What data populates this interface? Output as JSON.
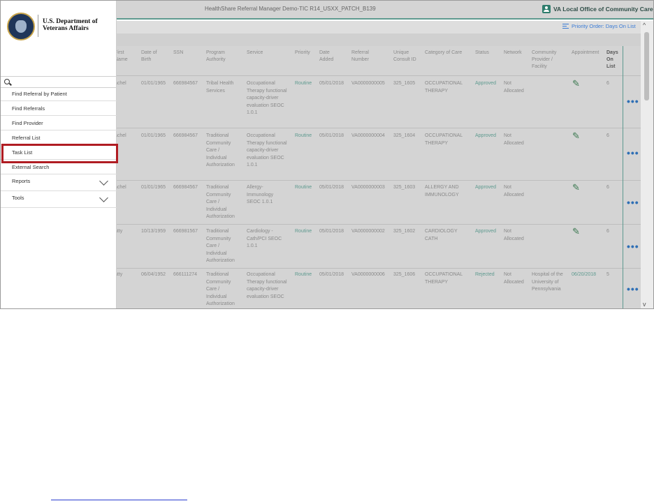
{
  "app": {
    "title": "HealthShare Referral Manager Demo-TIC R14_USXX_PATCH_B139",
    "office": "VA Local Office of Community Care",
    "priority_order": "Priority Order: Days On List"
  },
  "logo": {
    "org_name": "U.S. Department of Veterans Affairs"
  },
  "search": {
    "value": "",
    "placeholder": ""
  },
  "nav": {
    "items": [
      {
        "label": "Find Referral by Patient"
      },
      {
        "label": "Find Referrals"
      },
      {
        "label": "Find Provider"
      },
      {
        "label": "Referral List"
      },
      {
        "label": "Task List"
      },
      {
        "label": "External Search"
      },
      {
        "label": "Reports"
      },
      {
        "label": "Tools"
      }
    ]
  },
  "table": {
    "headers": {
      "first_name": "First Name",
      "dob": "Date of Birth",
      "ssn": "SSN",
      "program": "Program Authority",
      "service": "Service",
      "priority": "Priority",
      "date_added": "Date Added",
      "referral": "Referral Number",
      "consult": "Unique Consult ID",
      "category": "Category of Care",
      "status": "Status",
      "network": "Network",
      "provider": "Community Provider / Facility",
      "appointment": "Appointment",
      "days": "Days On List"
    },
    "rows": [
      {
        "first": "achel",
        "dob": "01/01/1965",
        "ssn": "666984567",
        "program": "Tribal Health Services",
        "service": "Occupational Therapy functional capacity-driver evaluation SEOC 1.0.1",
        "priority": "Routine",
        "added": "05/01/2018",
        "referral": "VA0000000005",
        "consult": "325_1605",
        "category": "OCCUPATIONAL THERAPY",
        "status": "Approved",
        "network": "Not Allocated",
        "provider": "",
        "appointment": "",
        "days": "6"
      },
      {
        "first": "achel",
        "dob": "01/01/1965",
        "ssn": "666984567",
        "program": "Traditional Community Care / Individual Authorization",
        "service": "Occupational Therapy functional capacity-driver evaluation SEOC 1.0.1",
        "priority": "Routine",
        "added": "05/01/2018",
        "referral": "VA0000000004",
        "consult": "325_1604",
        "category": "OCCUPATIONAL THERAPY",
        "status": "Approved",
        "network": "Not Allocated",
        "provider": "",
        "appointment": "",
        "days": "6"
      },
      {
        "first": "achel",
        "dob": "01/01/1965",
        "ssn": "666984567",
        "program": "Traditional Community Care / Individual Authorization",
        "service": "Allergy-Immunology SEOC 1.0.1",
        "priority": "Routine",
        "added": "05/01/2018",
        "referral": "VA0000000003",
        "consult": "325_1603",
        "category": "ALLERGY AND IMMUNOLOGY",
        "status": "Approved",
        "network": "Not Allocated",
        "provider": "",
        "appointment": "",
        "days": "6"
      },
      {
        "first": "atty",
        "dob": "10/13/1959",
        "ssn": "666981567",
        "program": "Traditional Community Care / Individual Authorization",
        "service": "Cardiology - Cath/PCI SEOC 1.0.1",
        "priority": "Routine",
        "added": "05/01/2018",
        "referral": "VA0000000002",
        "consult": "325_1602",
        "category": "CARDIOLOGY CATH",
        "status": "Approved",
        "network": "Not Allocated",
        "provider": "",
        "appointment": "",
        "days": "6"
      },
      {
        "first": "atty",
        "dob": "06/04/1952",
        "ssn": "666111274",
        "program": "Traditional Community Care / Individual Authorization",
        "service": "Occupational Therapy functional capacity-driver evaluation SEOC",
        "priority": "Routine",
        "added": "05/01/2018",
        "referral": "VA0000000006",
        "consult": "325_1606",
        "category": "OCCUPATIONAL THERAPY",
        "status": "Rejected",
        "network": "Not Allocated",
        "provider": "Hospital of the University of Pennsylvania",
        "appointment": "06/20/2018",
        "days": "5"
      }
    ]
  },
  "colors": {
    "accent": "#5e9a8f",
    "link": "#3a7bd5",
    "highlight": "#b01c22"
  },
  "icons": {
    "edit": "pencil-icon",
    "more": "ellipsis-icon",
    "search": "search-icon"
  }
}
